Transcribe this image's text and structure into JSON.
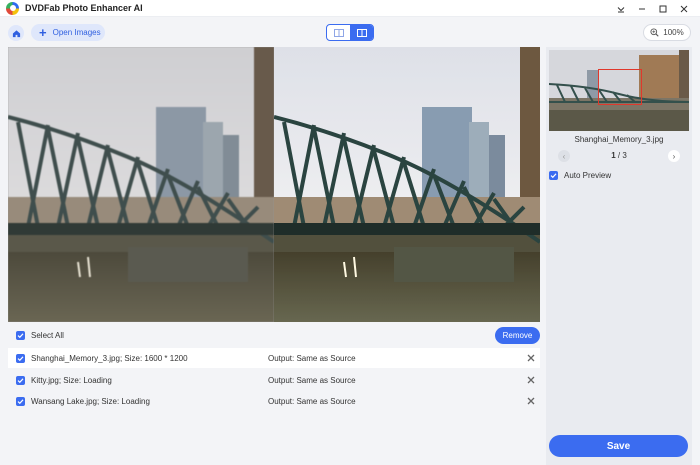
{
  "app": {
    "title": "DVDFab Photo Enhancer AI",
    "window_controls": [
      "settings-dropdown",
      "minimize",
      "maximize",
      "close"
    ]
  },
  "toolbar": {
    "open_label": "Open Images",
    "zoom_label": "100%",
    "view_modes": [
      "single-view",
      "split-view"
    ],
    "active_view": "split-view"
  },
  "list": {
    "select_all_label": "Select All",
    "select_all_checked": true,
    "remove_label": "Remove",
    "rows": [
      {
        "name": "Shanghai_Memory_3.jpg; Size: 1600 * 1200",
        "output": "Output: Same as Source",
        "checked": true
      },
      {
        "name": "Kitty.jpg; Size: Loading",
        "output": "Output: Same as Source",
        "checked": true
      },
      {
        "name": "Wansang Lake.jpg; Size: Loading",
        "output": "Output: Same as Source",
        "checked": true
      }
    ]
  },
  "side": {
    "file_name": "Shanghai_Memory_3.jpg",
    "page_current": "1",
    "page_sep": "/",
    "page_total": "3",
    "auto_preview_label": "Auto Preview",
    "auto_preview_checked": true,
    "save_label": "Save"
  },
  "colors": {
    "accent": "#3b6cf0",
    "accent_light": "#dfe7fb",
    "panel_bg": "#e9ebf0",
    "thumb_frame": "#e0382c"
  }
}
